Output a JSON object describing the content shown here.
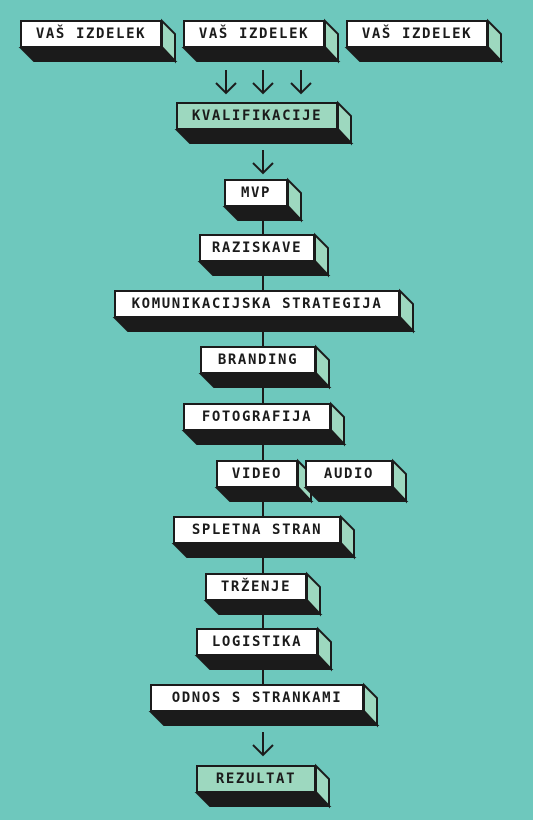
{
  "colors": {
    "background": "#6ec8bd",
    "box_face": "#ffffff",
    "box_face_highlight": "#9dd8bf",
    "box_side": "#9dd8bf",
    "box_bottom": "#1b1b1b",
    "stroke": "#1b1b1b"
  },
  "sources": [
    "VAŠ IZDELEK",
    "VAŠ IZDELEK",
    "VAŠ IZDELEK"
  ],
  "qualification": "KVALIFIKACIJE",
  "steps": {
    "mvp": "MVP",
    "research": "RAZISKAVE",
    "communication_strategy": "KOMUNIKACIJSKA STRATEGIJA",
    "branding": "BRANDING",
    "photography": "FOTOGRAFIJA",
    "video": "VIDEO",
    "audio": "AUDIO",
    "website": "SPLETNA STRAN",
    "marketing": "TRŽENJE",
    "logistics": "LOGISTIKA",
    "customer_relations": "ODNOS S STRANKAMI"
  },
  "result": "REZULTAT"
}
